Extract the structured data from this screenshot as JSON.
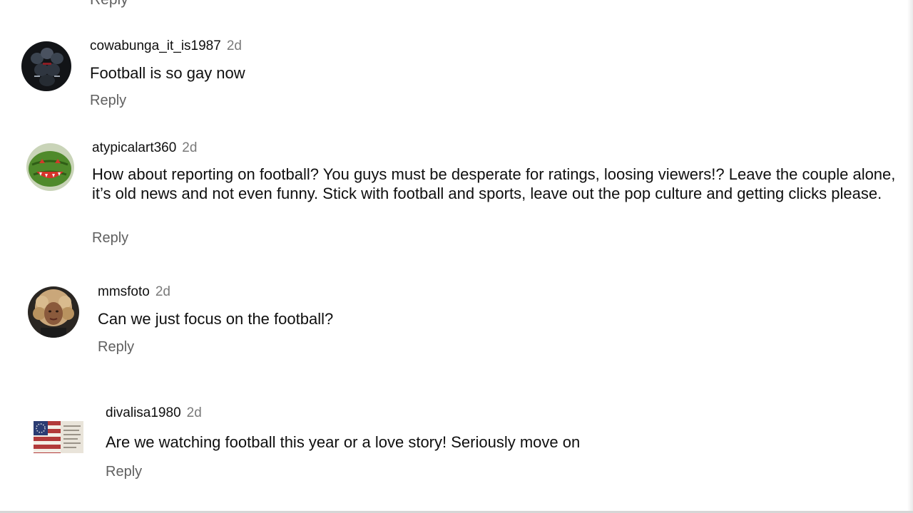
{
  "top_partial": {
    "reply_label": "Reply"
  },
  "comments": [
    {
      "author": "cowabunga_it_is1987",
      "time": "2d",
      "text": "Football is so gay now",
      "reply_label": "Reply",
      "avatar_icon": "helmets-avatar"
    },
    {
      "author": "atypicalart360",
      "time": "2d",
      "text": "How about reporting on football? You guys must be desperate for ratings, loosing viewers!? Leave the couple alone, it’s old news and not even funny. Stick with football and sports, leave out the pop culture and getting clicks please.",
      "reply_label": "Reply",
      "avatar_icon": "watermelon-avatar"
    },
    {
      "author": "mmsfoto",
      "time": "2d",
      "text": "Can we just focus on the football?",
      "reply_label": "Reply",
      "avatar_icon": "portrait-avatar"
    },
    {
      "author": "divalisa1980",
      "time": "2d",
      "text": "Are we watching football this year or a love story! Seriously move on",
      "reply_label": "Reply",
      "avatar_icon": "flag-avatar"
    }
  ],
  "colors": {
    "author": "#0f0f0f",
    "timestamp": "#7a7a7a",
    "reply": "#606060",
    "background": "#ffffff"
  }
}
